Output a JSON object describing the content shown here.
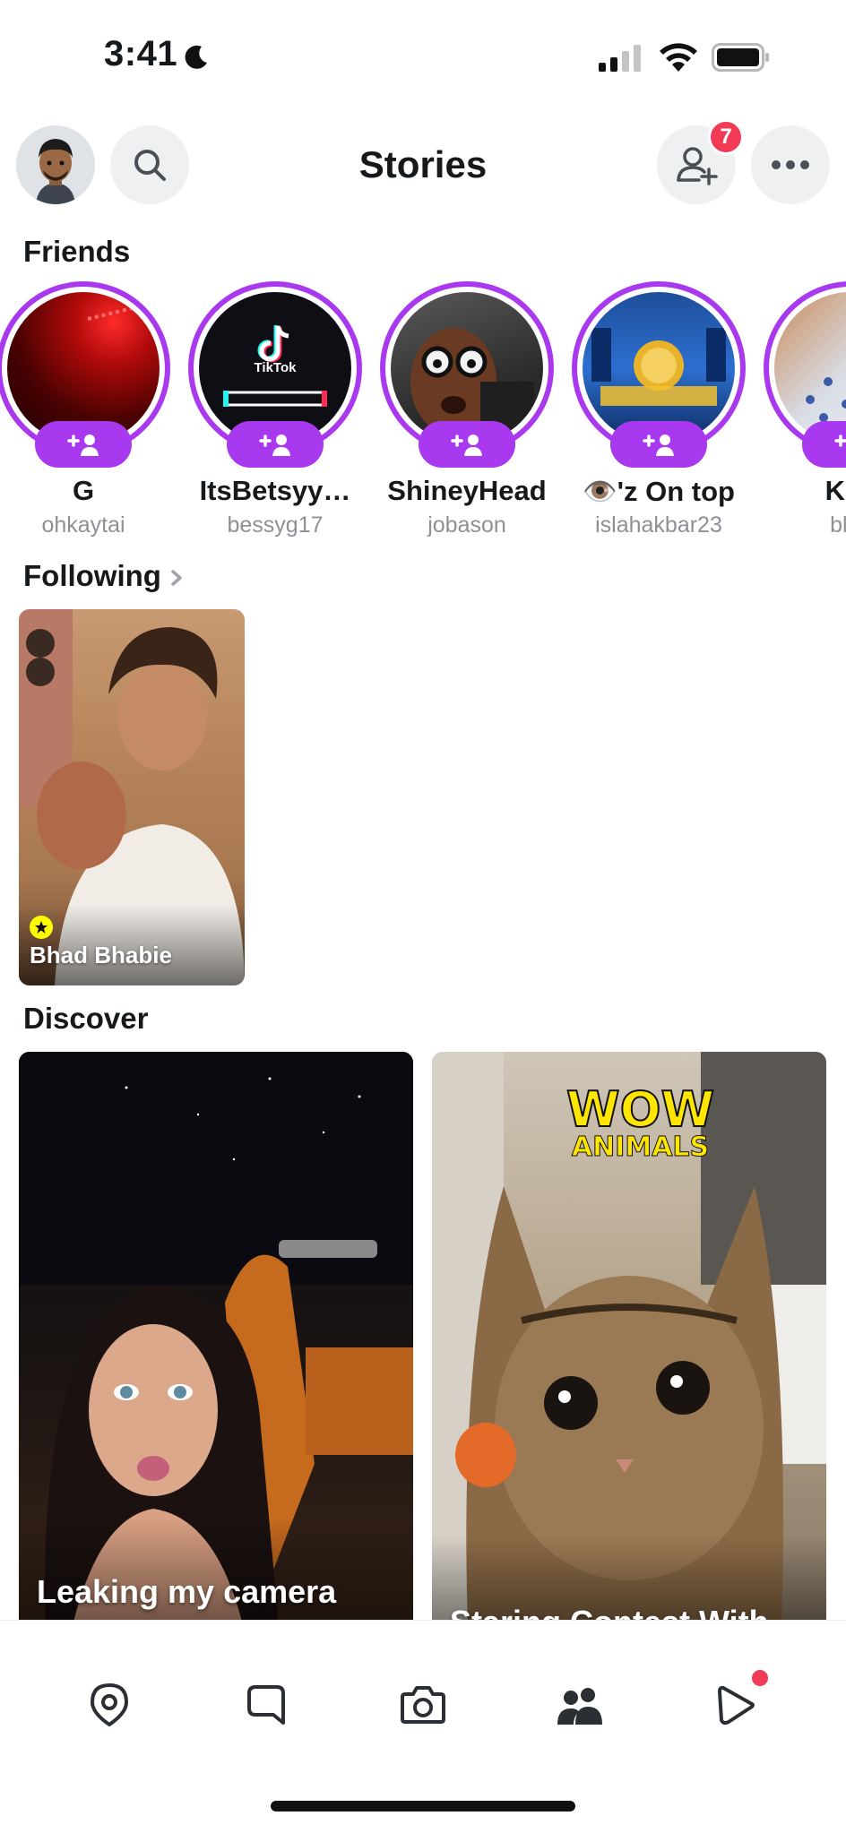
{
  "status_bar": {
    "time": "3:41"
  },
  "header": {
    "title": "Stories",
    "notification_count": "7"
  },
  "sections": {
    "friends": "Friends",
    "following": "Following",
    "discover": "Discover"
  },
  "friends": [
    {
      "name": "G",
      "username": "ohkaytai"
    },
    {
      "name": "ItsBetsyy…",
      "username": "bessyg17"
    },
    {
      "name": "ShineyHead",
      "username": "jobason"
    },
    {
      "name": "👁️'z On top",
      "username": "islahakbar23"
    },
    {
      "name": "Kay",
      "username": "blas"
    }
  ],
  "friend_thumbs": {
    "tiktok_text": "TikTok"
  },
  "following": [
    {
      "name": "Bhad Bhabie"
    }
  ],
  "discover": [
    {
      "title": "Leaking my camera"
    },
    {
      "title": "Staring Contest With",
      "logo_top": "WOW",
      "logo_bottom": "ANIMALS"
    }
  ],
  "colors": {
    "accent_purple": "#a939ee",
    "badge_red": "#f23c57",
    "snap_yellow": "#fffc00"
  },
  "nav": [
    {
      "icon": "map-pin-icon"
    },
    {
      "icon": "chat-icon"
    },
    {
      "icon": "camera-icon"
    },
    {
      "icon": "stories-icon"
    },
    {
      "icon": "spotlight-icon"
    }
  ]
}
